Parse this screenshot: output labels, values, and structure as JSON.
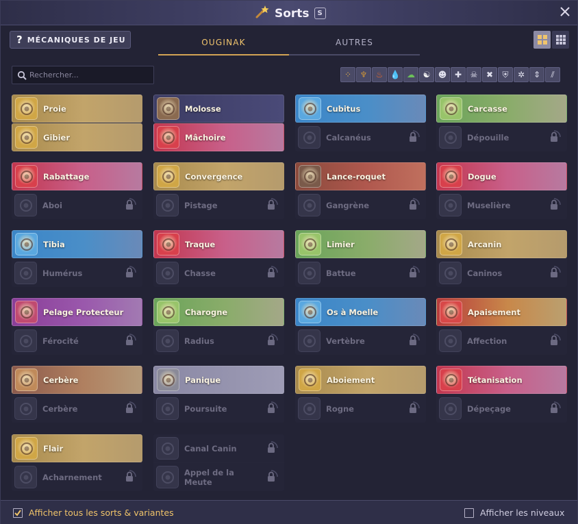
{
  "window": {
    "title": "Sorts",
    "shortcut_key": "S",
    "title_icon": "magic-wand-icon",
    "close_icon": "close-icon"
  },
  "toolbar": {
    "mechanics_icon_text": "?",
    "mechanics_label": "MÉCANIQUES DE JEU",
    "view_toggle_active": "large-grid",
    "view_toggle_inactive": "small-grid"
  },
  "tabs": [
    {
      "label": "OUGINAK",
      "active": true
    },
    {
      "label": "AUTRES",
      "active": false
    }
  ],
  "search": {
    "placeholder": "Rechercher..."
  },
  "filters": [
    {
      "icon": "multi-element-icon",
      "glyph": "⁘",
      "color": "#e8b24a"
    },
    {
      "icon": "earth-icon",
      "glyph": "♆",
      "color": "#c8913a"
    },
    {
      "icon": "fire-icon",
      "glyph": "♨",
      "color": "#ec6a2a"
    },
    {
      "icon": "water-icon",
      "glyph": "💧",
      "color": "#4a9fe8"
    },
    {
      "icon": "air-icon",
      "glyph": "☁",
      "color": "#6cc05a"
    },
    {
      "icon": "neutral-icon",
      "glyph": "☯",
      "color": "#f0f0f0"
    },
    {
      "icon": "monster-icon",
      "glyph": "☻",
      "color": "#e0e0ee"
    },
    {
      "icon": "heal-icon",
      "glyph": "✚",
      "color": "#e0e0ee"
    },
    {
      "icon": "summon-icon",
      "glyph": "☠",
      "color": "#e0e0ee"
    },
    {
      "icon": "crossed-icon",
      "glyph": "✖",
      "color": "#e0e0ee"
    },
    {
      "icon": "shield-icon",
      "glyph": "⛨",
      "color": "#e0e0ee"
    },
    {
      "icon": "buff-icon",
      "glyph": "✲",
      "color": "#e0e0ee"
    },
    {
      "icon": "movement-icon",
      "glyph": "⇕",
      "color": "#e0e0ee"
    },
    {
      "icon": "slash-icon",
      "glyph": "⫽",
      "color": "#e0e0ee"
    }
  ],
  "spell_pairs": [
    {
      "top": {
        "name": "Proie",
        "element": "earth",
        "icon": "prey-icon",
        "unlocked": true
      },
      "bottom": {
        "name": "Gibier",
        "element": "earth",
        "icon": "game-icon",
        "unlocked": true
      }
    },
    {
      "top": {
        "name": "Molosse",
        "element": "neutral",
        "icon": "molossus-icon",
        "unlocked": true
      },
      "bottom": {
        "name": "Mâchoire",
        "element": "fire",
        "icon": "jaw-icon",
        "unlocked": true
      }
    },
    {
      "top": {
        "name": "Cubitus",
        "element": "water",
        "icon": "cubitus-icon",
        "unlocked": true
      },
      "bottom": {
        "name": "Calcanéus",
        "element": "water",
        "icon": "calcaneus-icon",
        "unlocked": false
      }
    },
    {
      "top": {
        "name": "Carcasse",
        "element": "air",
        "icon": "carcass-icon",
        "unlocked": true
      },
      "bottom": {
        "name": "Dépouille",
        "element": "air",
        "icon": "remains-icon",
        "unlocked": false
      }
    },
    {
      "top": {
        "name": "Rabattage",
        "element": "fire",
        "icon": "rabattage-icon",
        "unlocked": true
      },
      "bottom": {
        "name": "Aboi",
        "element": "fire",
        "icon": "bark-icon",
        "unlocked": false
      }
    },
    {
      "top": {
        "name": "Convergence",
        "element": "earth",
        "icon": "convergence-icon",
        "unlocked": true
      },
      "bottom": {
        "name": "Pistage",
        "element": "earth",
        "icon": "tracking-icon",
        "unlocked": false
      }
    },
    {
      "top": {
        "name": "Lance-roquet",
        "element": "earth-fire",
        "icon": "dog-launcher-icon",
        "unlocked": true
      },
      "bottom": {
        "name": "Gangrène",
        "element": "earth-fire",
        "icon": "gangrene-icon",
        "unlocked": false
      }
    },
    {
      "top": {
        "name": "Dogue",
        "element": "fire",
        "icon": "mastiff-icon",
        "unlocked": true
      },
      "bottom": {
        "name": "Muselière",
        "element": "fire",
        "icon": "muzzle-icon",
        "unlocked": false
      }
    },
    {
      "top": {
        "name": "Tibia",
        "element": "water",
        "icon": "tibia-icon",
        "unlocked": true
      },
      "bottom": {
        "name": "Humérus",
        "element": "water",
        "icon": "humerus-icon",
        "unlocked": false
      }
    },
    {
      "top": {
        "name": "Traque",
        "element": "fire",
        "icon": "hunt-icon",
        "unlocked": true
      },
      "bottom": {
        "name": "Chasse",
        "element": "fire",
        "icon": "chase-icon",
        "unlocked": false
      }
    },
    {
      "top": {
        "name": "Limier",
        "element": "air",
        "icon": "bloodhound-icon",
        "unlocked": true
      },
      "bottom": {
        "name": "Battue",
        "element": "air",
        "icon": "beat-icon",
        "unlocked": false
      }
    },
    {
      "top": {
        "name": "Arcanin",
        "element": "earth",
        "icon": "arcanin-icon",
        "unlocked": true
      },
      "bottom": {
        "name": "Caninos",
        "element": "earth",
        "icon": "caninos-icon",
        "unlocked": false
      }
    },
    {
      "top": {
        "name": "Pelage Protecteur",
        "element": "utility",
        "icon": "protective-fur-icon",
        "unlocked": true
      },
      "bottom": {
        "name": "Férocité",
        "element": "utility",
        "icon": "ferocity-icon",
        "unlocked": false
      }
    },
    {
      "top": {
        "name": "Charogne",
        "element": "air",
        "icon": "carrion-icon",
        "unlocked": true
      },
      "bottom": {
        "name": "Radius",
        "element": "air",
        "icon": "radius-icon",
        "unlocked": false
      }
    },
    {
      "top": {
        "name": "Os à Moelle",
        "element": "water",
        "icon": "marrow-bone-icon",
        "unlocked": true
      },
      "bottom": {
        "name": "Vertèbre",
        "element": "water",
        "icon": "vertebra-icon",
        "unlocked": false
      }
    },
    {
      "top": {
        "name": "Apaisement",
        "element": "fire-earth",
        "icon": "appeasement-icon",
        "unlocked": true
      },
      "bottom": {
        "name": "Affection",
        "element": "fire-earth",
        "icon": "affection-icon",
        "unlocked": false
      }
    },
    {
      "top": {
        "name": "Cerbère",
        "element": "fire-earth-dim",
        "icon": "cerberus-icon",
        "unlocked": true
      },
      "bottom": {
        "name": "Cerbère",
        "element": "fire-earth-dim",
        "icon": "cerberus-icon",
        "unlocked": false
      }
    },
    {
      "top": {
        "name": "Panique",
        "element": "neutral-light",
        "icon": "panic-icon",
        "unlocked": true
      },
      "bottom": {
        "name": "Poursuite",
        "element": "neutral-light",
        "icon": "pursuit-icon",
        "unlocked": false
      }
    },
    {
      "top": {
        "name": "Aboiement",
        "element": "earth",
        "icon": "barking-icon",
        "unlocked": true
      },
      "bottom": {
        "name": "Rogne",
        "element": "earth",
        "icon": "rogne-icon",
        "unlocked": false
      }
    },
    {
      "top": {
        "name": "Tétanisation",
        "element": "fire",
        "icon": "tetanization-icon",
        "unlocked": true
      },
      "bottom": {
        "name": "Dépeçage",
        "element": "fire",
        "icon": "skinning-icon",
        "unlocked": false
      }
    },
    {
      "top": {
        "name": "Flair",
        "element": "earth",
        "icon": "scent-icon",
        "unlocked": true
      },
      "bottom": {
        "name": "Acharnement",
        "element": "earth",
        "icon": "relentless-icon",
        "unlocked": false
      }
    },
    {
      "top": {
        "name": "Canal Canin",
        "element": "locked",
        "icon": "canine-channel-icon",
        "unlocked": false
      },
      "bottom": {
        "name": "Appel de la Meute",
        "element": "locked",
        "icon": "pack-call-icon",
        "unlocked": false
      }
    }
  ],
  "footer": {
    "show_all_label": "Afficher tous les sorts & variantes",
    "show_all_checked": true,
    "show_levels_label": "Afficher les niveaux",
    "show_levels_checked": false
  },
  "colors": {
    "accent": "#f0c46d",
    "earth": "#c9a24a",
    "fire": "#d8445a",
    "water": "#3f8fd0",
    "air": "#7fb85a",
    "neutral": "#4a4a78",
    "utility": "#a04a9a"
  }
}
